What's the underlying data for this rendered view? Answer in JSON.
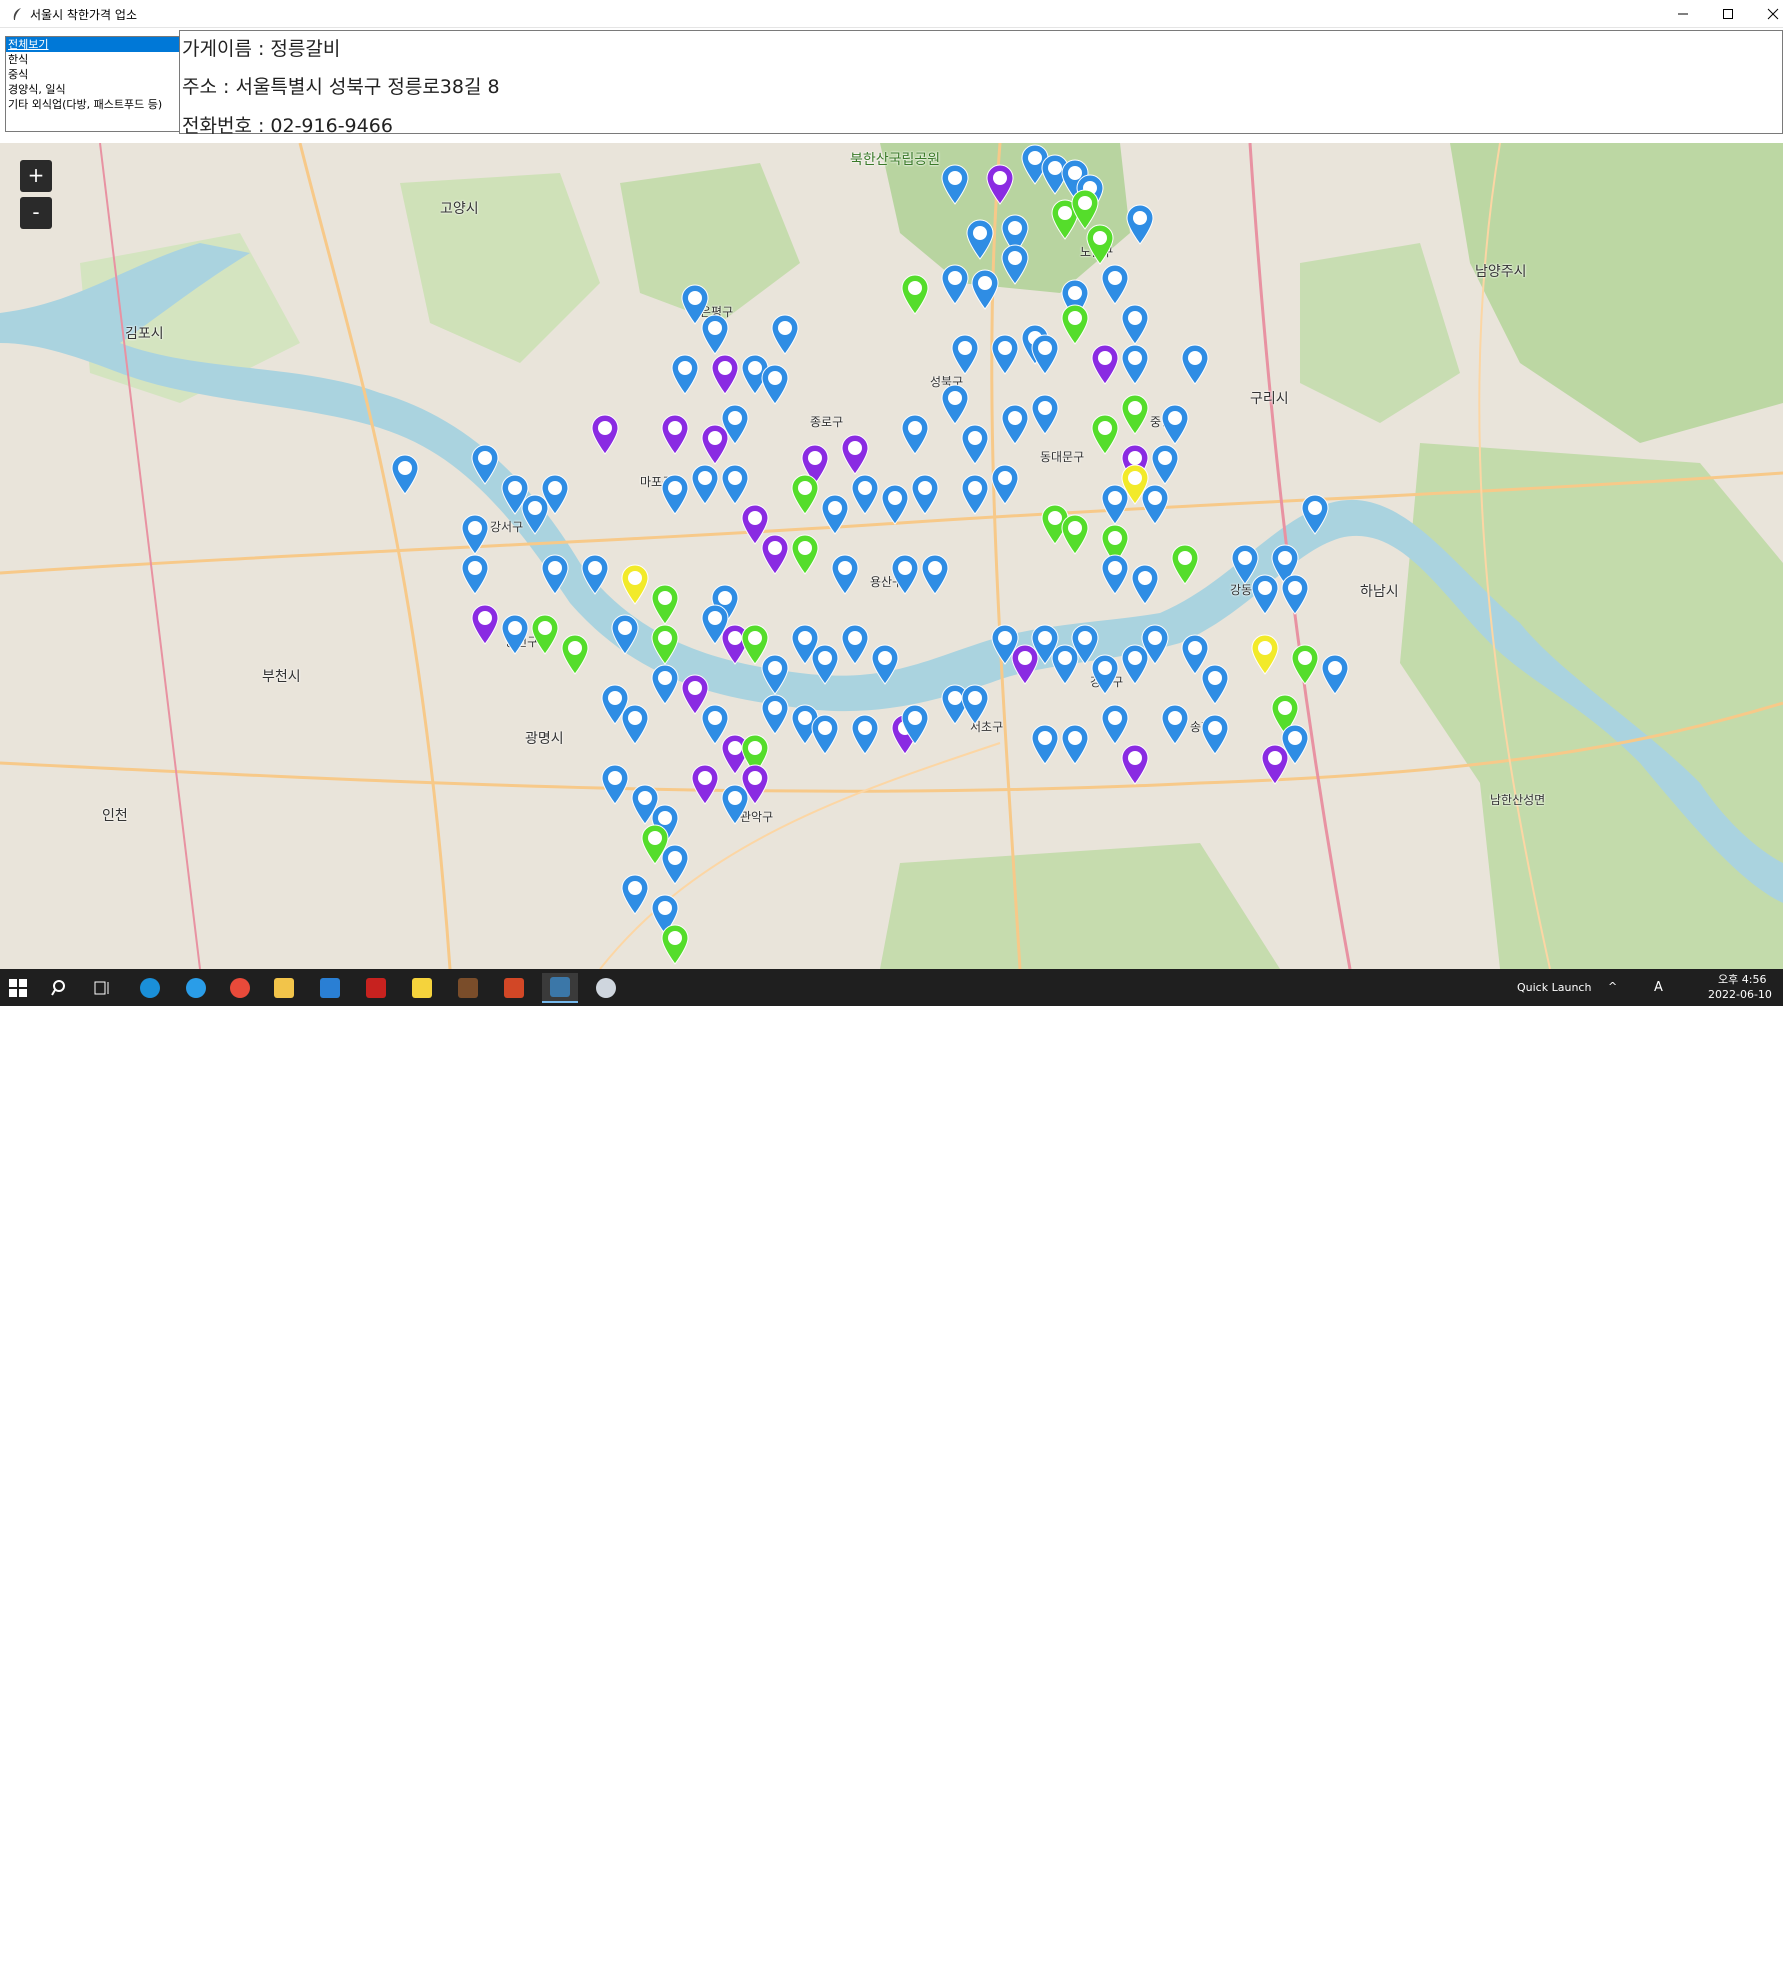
{
  "window": {
    "title": "서울시 착한가격 업소"
  },
  "categories": {
    "items": [
      {
        "label": "전체보기",
        "selected": true
      },
      {
        "label": "한식"
      },
      {
        "label": "중식"
      },
      {
        "label": "경양식, 일식"
      },
      {
        "label": "기타 외식업(다방, 패스트푸드 등)"
      }
    ]
  },
  "store": {
    "name_line": "가게이름 : 정릉갈비",
    "address_line": "주소 : 서울특별시 성북구 정릉로38길 8",
    "phone_line": "전화번호 : 02-916-9466"
  },
  "map": {
    "zoom_in": "+",
    "zoom_out": "-",
    "labels": [
      "북한산국립공원",
      "고양시",
      "김포시",
      "남양주시",
      "구리시",
      "하남시",
      "부천시",
      "광명시",
      "인천",
      "양천구",
      "강서구",
      "용산구",
      "동대문구",
      "중랑구",
      "강동구",
      "송파구",
      "서초구",
      "마포구",
      "종로구",
      "성북구",
      "노원구",
      "은평구",
      "강남구",
      "관악구",
      "남한산성면"
    ],
    "marker_colors": {
      "blue": "#2f8de4",
      "purple": "#8a2be2",
      "green": "#55dd2b",
      "yellow": "#f2ea2a"
    }
  },
  "taskbar": {
    "quick_launch": "Quick Launch",
    "time": "오후 4:56",
    "date": "2022-06-10",
    "ime": "A"
  }
}
